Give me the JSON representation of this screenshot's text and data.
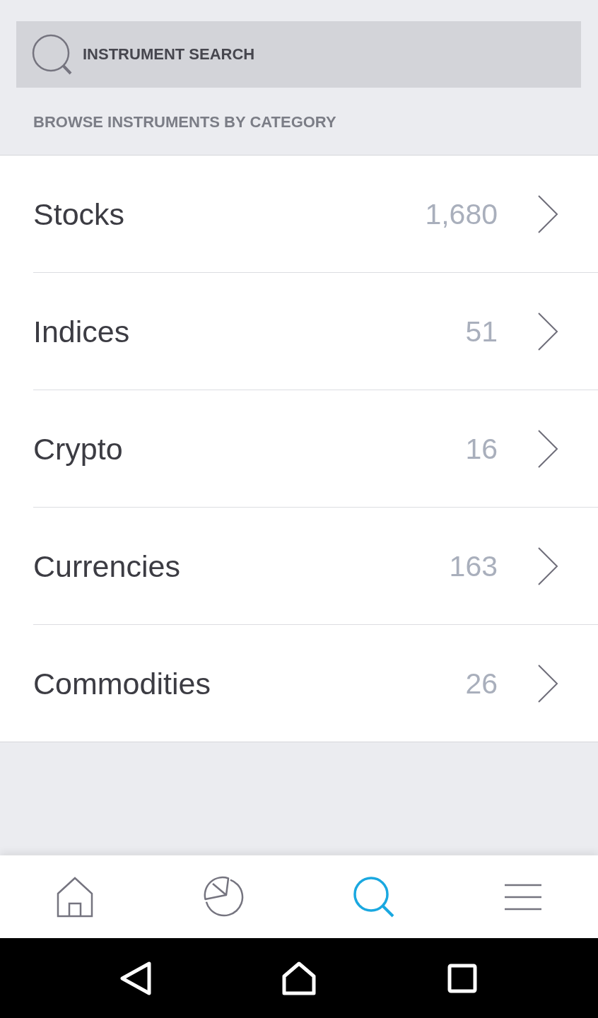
{
  "search": {
    "placeholder": "INSTRUMENT SEARCH"
  },
  "section_title": "BROWSE INSTRUMENTS BY CATEGORY",
  "categories": [
    {
      "name": "Stocks",
      "count": "1,680"
    },
    {
      "name": "Indices",
      "count": "51"
    },
    {
      "name": "Crypto",
      "count": "16"
    },
    {
      "name": "Currencies",
      "count": "163"
    },
    {
      "name": "Commodities",
      "count": "26"
    }
  ],
  "tabs": [
    {
      "kind": "home",
      "selected": false
    },
    {
      "kind": "portfolio",
      "selected": false
    },
    {
      "kind": "search",
      "selected": true
    },
    {
      "kind": "menu",
      "selected": false
    }
  ]
}
